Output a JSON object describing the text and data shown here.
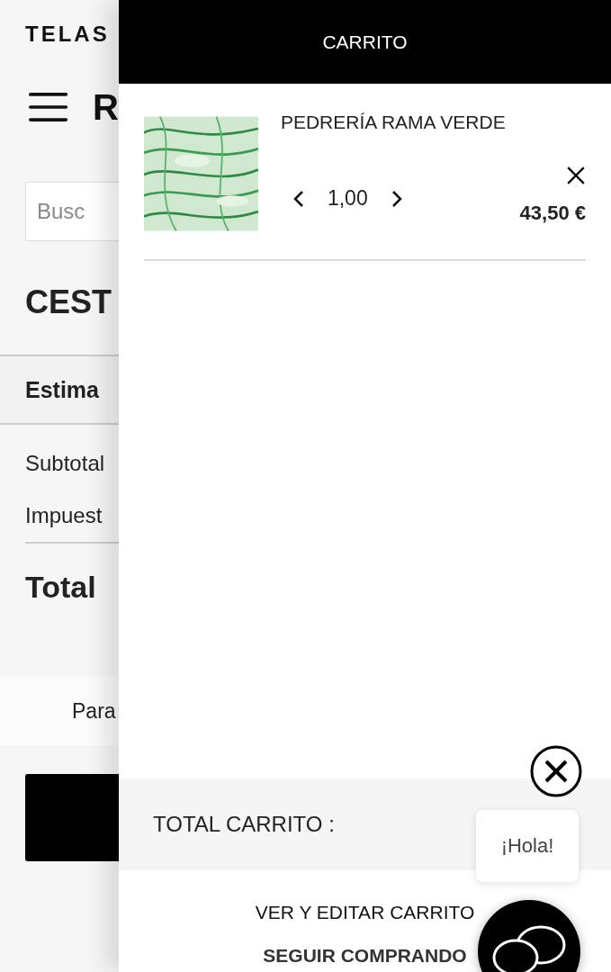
{
  "background_page": {
    "brand": "TELAS",
    "logo": "R",
    "search": {
      "placeholder": "Busc"
    },
    "title": "CEST",
    "shipping_heading": "Estima",
    "summary_rows": [
      "Subtotal",
      "Impuest"
    ],
    "total_label": "Total",
    "note": "Para"
  },
  "cart_drawer": {
    "title": "CARRITO",
    "items": [
      {
        "name": "PEDRERÍA RAMA VERDE",
        "quantity": "1,00",
        "price": "43,50 €"
      }
    ],
    "total_label": "TOTAL CARRITO :",
    "links": [
      {
        "text": "VER Y EDITAR CARRITO",
        "kind": "plain"
      },
      {
        "text": "SEGUIR COMPRANDO",
        "kind": "strong"
      }
    ]
  },
  "chat": {
    "greeting": "¡Hola!"
  }
}
